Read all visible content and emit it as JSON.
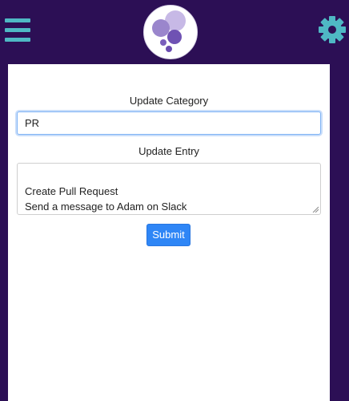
{
  "header": {
    "menu_icon": "hamburger-menu-icon",
    "logo_icon": "bubbles-logo",
    "settings_icon": "gear-icon"
  },
  "form": {
    "category_label": "Update Category",
    "category_value": "PR",
    "entry_label": "Update Entry",
    "entry_value": "Create Pull Request\nSend a message to Adam on Slack",
    "submit_label": "Submit"
  },
  "colors": {
    "background": "#2c0f55",
    "accent": "#4fb8c4",
    "button": "#2f86f6"
  }
}
